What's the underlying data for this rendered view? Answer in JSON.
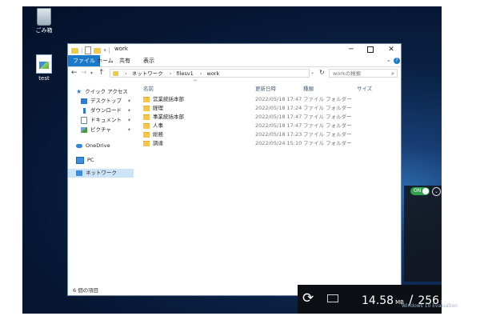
{
  "desktop": {
    "icons": [
      {
        "label": "ごみ箱"
      },
      {
        "label": "test"
      }
    ]
  },
  "window": {
    "title": "work",
    "controls": {
      "minimize": "─",
      "maximize": "",
      "close": "✕"
    }
  },
  "ribbon": {
    "tabs": [
      "ファイル",
      "ホーム",
      "共有",
      "表示"
    ]
  },
  "address": {
    "crumbs": [
      "ネットワーク",
      "filesv1",
      "work"
    ],
    "separator": "›"
  },
  "search": {
    "placeholder": "workの検索"
  },
  "sidebar": {
    "items": [
      {
        "label": "クイック アクセス",
        "icon": "star-icon"
      },
      {
        "label": "デスクトップ",
        "icon": "desktop-icon",
        "pinned": true
      },
      {
        "label": "ダウンロード",
        "icon": "download-icon",
        "pinned": true
      },
      {
        "label": "ドキュメント",
        "icon": "documents-icon",
        "pinned": true
      },
      {
        "label": "ピクチャ",
        "icon": "pictures-icon",
        "pinned": true
      },
      {
        "label": "OneDrive",
        "icon": "onedrive-icon"
      },
      {
        "label": "PC",
        "icon": "pc-icon"
      },
      {
        "label": "ネットワーク",
        "icon": "network-icon",
        "selected": true
      }
    ]
  },
  "columns": {
    "name": "名前",
    "modified": "更新日時",
    "type": "種類",
    "size": "サイズ"
  },
  "files": [
    {
      "name": "営業統括本部",
      "date": "2022/05/18 17:47",
      "type": "ファイル フォルダー"
    },
    {
      "name": "経理",
      "date": "2022/05/18 17:24",
      "type": "ファイル フォルダー"
    },
    {
      "name": "事業統括本部",
      "date": "2022/05/18 17:47",
      "type": "ファイル フォルダー"
    },
    {
      "name": "人事",
      "date": "2022/05/18 17:47",
      "type": "ファイル フォルダー"
    },
    {
      "name": "総務",
      "date": "2022/05/18 17:23",
      "type": "ファイル フォルダー"
    },
    {
      "name": "調達",
      "date": "2022/05/24 15:10",
      "type": "ファイル フォルダー"
    }
  ],
  "status": {
    "count": "6 個の項目"
  },
  "overlay": {
    "toggle": "ON",
    "mem_used": "14.58",
    "mem_used_unit": "MB",
    "mem_total": "256",
    "mem_total_unit": "MB",
    "separator": "/",
    "watermark": "Windows 10 Evaluation"
  }
}
